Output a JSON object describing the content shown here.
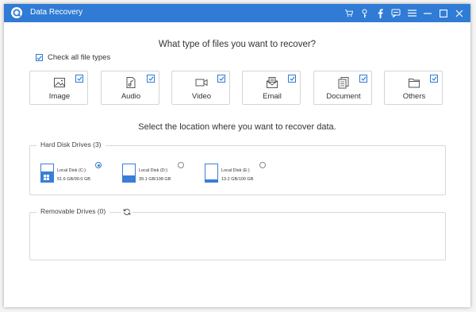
{
  "window": {
    "title": "Data Recovery"
  },
  "titlebar_icons": [
    "cart-icon",
    "key-icon",
    "facebook-icon",
    "feedback-icon",
    "menu-icon",
    "minimize-icon",
    "maximize-icon",
    "close-icon"
  ],
  "file_types": {
    "heading": "What type of files you want to recover?",
    "check_all_label": "Check all file types",
    "items": [
      {
        "label": "Image",
        "icon": "image-icon",
        "checked": true
      },
      {
        "label": "Audio",
        "icon": "audio-icon",
        "checked": true
      },
      {
        "label": "Video",
        "icon": "video-icon",
        "checked": true
      },
      {
        "label": "Email",
        "icon": "email-icon",
        "checked": true
      },
      {
        "label": "Document",
        "icon": "document-icon",
        "checked": true
      },
      {
        "label": "Others",
        "icon": "folder-icon",
        "checked": true
      }
    ]
  },
  "location": {
    "heading": "Select the location where you want to recover data.",
    "hard_disk": {
      "title": "Hard Disk Drives (3)",
      "drives": [
        {
          "name": "Local Disk (C:)",
          "size": "51.6 GB/90.0 GB",
          "used_fraction": 0.57,
          "selected": true
        },
        {
          "name": "Local Disk (D:)",
          "size": "39.1 GB/108 GB",
          "used_fraction": 0.36,
          "selected": false
        },
        {
          "name": "Local Disk (E:)",
          "size": "13.2 GB/100 GB",
          "used_fraction": 0.13,
          "selected": false
        }
      ]
    },
    "removable": {
      "title": "Removable Drives (0)"
    }
  },
  "colors": {
    "accent": "#2f7bd5",
    "drive_fill": "#3a7ed6"
  }
}
